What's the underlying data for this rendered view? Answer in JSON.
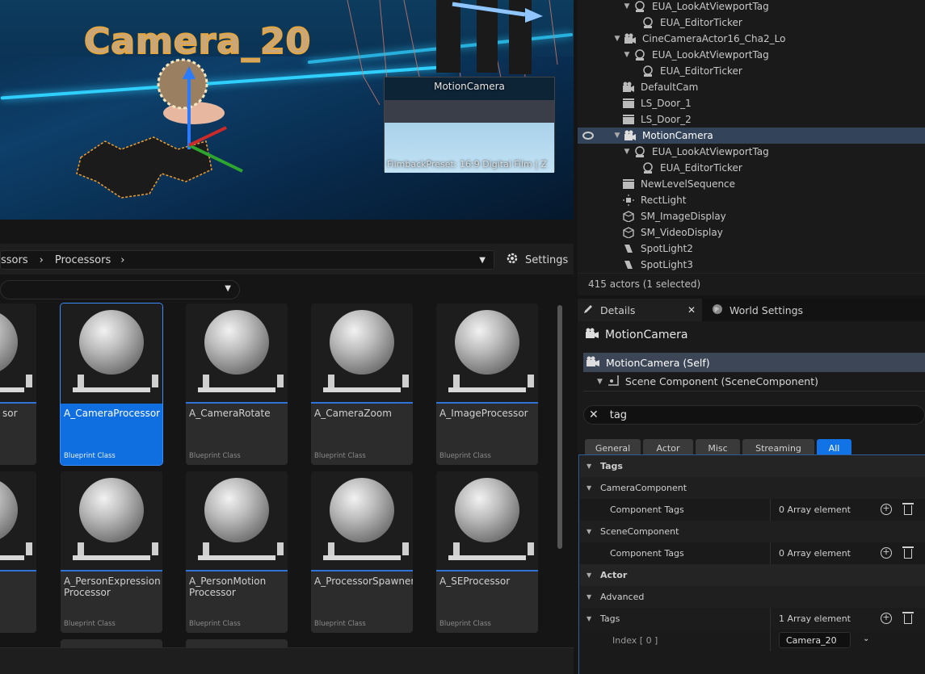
{
  "viewport": {
    "camera_label": "Camera_20",
    "pip_title": "MotionCamera",
    "pip_info": "FilmbackPreset: 16:9 Digital Film | Z"
  },
  "outliner": {
    "items": [
      {
        "label": "EUA_LookAtViewportTag",
        "icon": "actor-component-icon"
      },
      {
        "label": "EUA_EditorTicker",
        "icon": "actor-component-icon"
      },
      {
        "label": "CineCameraActor16_Cha2_Lo",
        "icon": "camera-icon"
      },
      {
        "label": "EUA_LookAtViewportTag",
        "icon": "actor-component-icon"
      },
      {
        "label": "EUA_EditorTicker",
        "icon": "actor-component-icon"
      },
      {
        "label": "DefaultCam",
        "icon": "camera-icon"
      },
      {
        "label": "LS_Door_1",
        "icon": "level-sequence-icon"
      },
      {
        "label": "LS_Door_2",
        "icon": "level-sequence-icon"
      },
      {
        "label": "MotionCamera",
        "icon": "camera-icon"
      },
      {
        "label": "EUA_LookAtViewportTag",
        "icon": "actor-component-icon"
      },
      {
        "label": "EUA_EditorTicker",
        "icon": "actor-component-icon"
      },
      {
        "label": "NewLevelSequence",
        "icon": "level-sequence-icon"
      },
      {
        "label": "RectLight",
        "icon": "rect-light-icon"
      },
      {
        "label": "SM_ImageDisplay",
        "icon": "static-mesh-icon"
      },
      {
        "label": "SM_VideoDisplay",
        "icon": "static-mesh-icon"
      },
      {
        "label": "SpotLight2",
        "icon": "spot-light-icon"
      },
      {
        "label": "SpotLight3",
        "icon": "spot-light-icon"
      }
    ],
    "footer": "415 actors (1 selected)"
  },
  "content_browser": {
    "path": [
      "ssors",
      "Processors"
    ],
    "settings_label": "Settings",
    "assets": [
      {
        "name": "sor",
        "type": ""
      },
      {
        "name": "A_CameraProcessor",
        "type": "Blueprint Class"
      },
      {
        "name": "A_CameraRotate",
        "type": "Blueprint Class"
      },
      {
        "name": "A_CameraZoom",
        "type": "Blueprint Class"
      },
      {
        "name": "A_ImageProcessor",
        "type": "Blueprint Class"
      },
      {
        "name": "",
        "type": ""
      },
      {
        "name": "A_PersonExpression Processor",
        "type": "Blueprint Class"
      },
      {
        "name": "A_PersonMotion Processor",
        "type": "Blueprint Class"
      },
      {
        "name": "A_ProcessorSpawner",
        "type": "Blueprint Class"
      },
      {
        "name": "A_SEProcessor",
        "type": "Blueprint Class"
      }
    ]
  },
  "details": {
    "tab_details": "Details",
    "tab_world": "World Settings",
    "actor_name": "MotionCamera",
    "component_self": "MotionCamera (Self)",
    "component_scene": "Scene Component (SceneComponent)",
    "search_value": "tag",
    "categories": [
      "General",
      "Actor",
      "Misc",
      "Streaming",
      "All"
    ],
    "sections": {
      "tags_header": "Tags",
      "camera_component": "CameraComponent",
      "camera_component_tags_label": "Component Tags",
      "camera_component_tags_value": "0 Array element",
      "scene_component": "SceneComponent",
      "scene_component_tags_label": "Component Tags",
      "scene_component_tags_value": "0 Array element",
      "actor_header": "Actor",
      "advanced": "Advanced",
      "actor_tags_label": "Tags",
      "actor_tags_value": "1 Array element",
      "index_label": "Index [ 0 ]",
      "index_value": "Camera_20"
    }
  }
}
